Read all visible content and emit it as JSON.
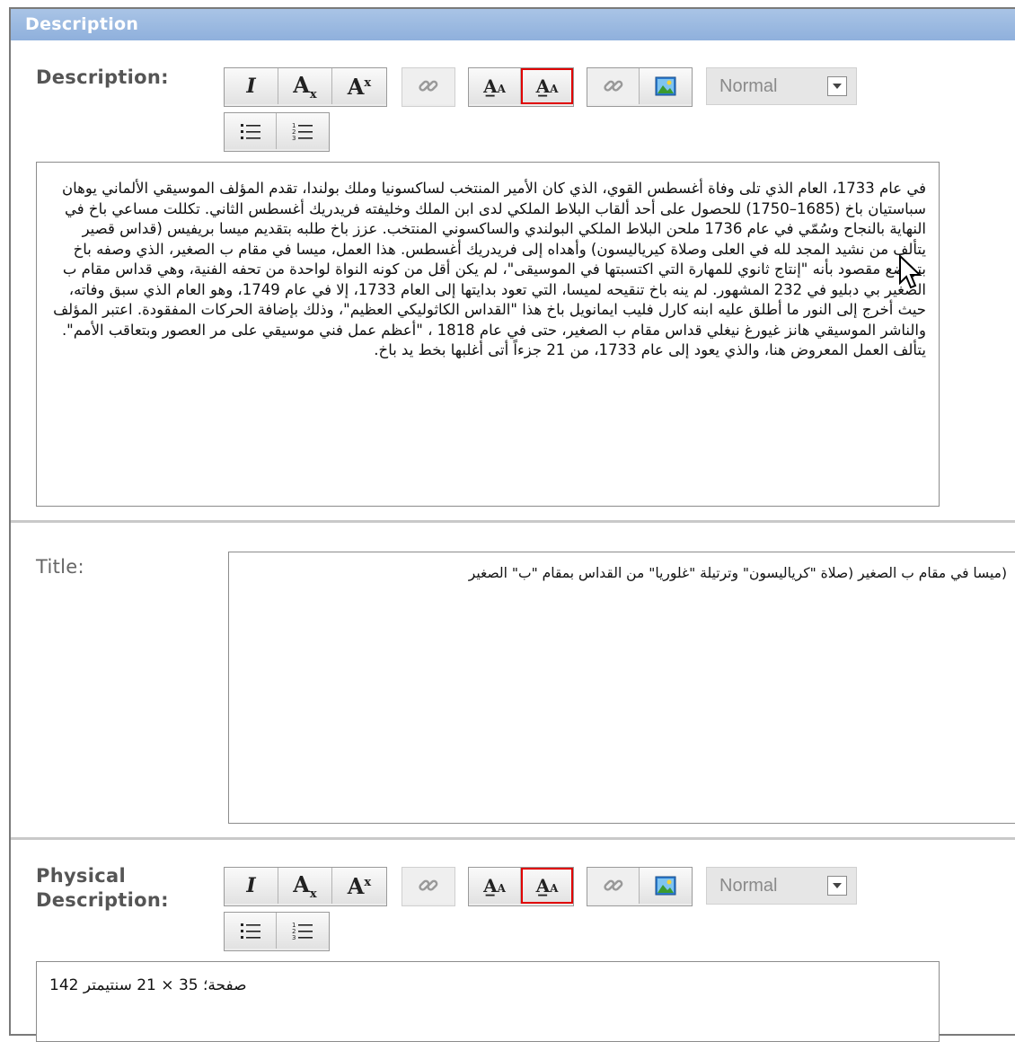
{
  "section": {
    "title": "Description"
  },
  "description": {
    "label": "Description:",
    "text": "في عام 1733، العام الذي تلى وفاة أغسطس القوي، الذي كان الأمير المنتخب لساكسونيا وملك بولندا، تقدم المؤلف الموسيقي الألماني يوهان سباستيان باخ (1685–1750) للحصول على أحد ألقاب البلاط الملكي لدى ابن الملك وخليفته فريدريك أغسطس الثاني. تكللت مساعي باخ في النهاية بالنجاح وسُمّي في عام 1736 ملحن البلاط الملكي البولندي والساكسوني المنتخب. عزز باخ طلبه بتقديم ميسا بريفيس (قداس قصير يتألف من نشيد المجد لله في العلى وصلاة كيرياليسون) وأهداه إلى فريدريك أغسطس. هذا العمل، ميسا في مقام ب الصغير، الذي وصفه باخ بتواضع مقصود بأنه \"إنتاج ثانوي للمهارة التي اكتسبتها في الموسيقى\"، لم يكن أقل من كونه النواة لواحدة من تحفه الفنية، وهي قداس مقام ب الصغير بي دبليو في 232 المشهور. لم ينه باخ تنقيحه لميسا، التي تعود بدايتها إلى العام 1733، إلا في عام 1749، وهو العام الذي سبق وفاته، حيث أخرج إلى النور ما أطلق عليه ابنه كارل فليب ايمانويل باخ هذا \"القداس الكاثوليكي العظيم\"، وذلك بإضافة الحركات المفقودة. اعتبر المؤلف والناشر الموسيقي هانز غيورغ نيغلي قداس مقام ب الصغير، حتى في عام 1818 ، \"أعظم عمل فني موسيقي على مر العصور وبتعاقب الأمم\". يتألف العمل المعروض هنا، والذي يعود إلى عام 1733، من 21 جزءاً أتى أغلبها بخط يد باخ."
  },
  "title_field": {
    "label": "Title:",
    "text": "(ميسا في مقام ب الصغير (صلاة \"كرياليسون\" وترتيلة \"غلوريا\" من القداس بمقام \"ب\" الصغير"
  },
  "physical": {
    "label_line1": "Physical",
    "label_line2": "Description:",
    "text": "صفحة؛ 35 × 21 سنتيمتر 142"
  },
  "toolbar": {
    "italic": "I",
    "subscript": "A",
    "subscript_mark": "x",
    "superscript": "A",
    "superscript_mark": "x",
    "format_value": "Normal",
    "icons": [
      "italic-icon",
      "subscript-icon",
      "superscript-icon",
      "link-icon",
      "font-size-increase-icon",
      "font-size-decrease-icon",
      "unlink-icon",
      "image-icon",
      "chevron-down-icon",
      "bullet-list-icon",
      "numbered-list-icon"
    ]
  },
  "colors": {
    "header_bg": "#9dbbe2",
    "active_outline": "#e00000",
    "border": "#7a7a7a"
  }
}
